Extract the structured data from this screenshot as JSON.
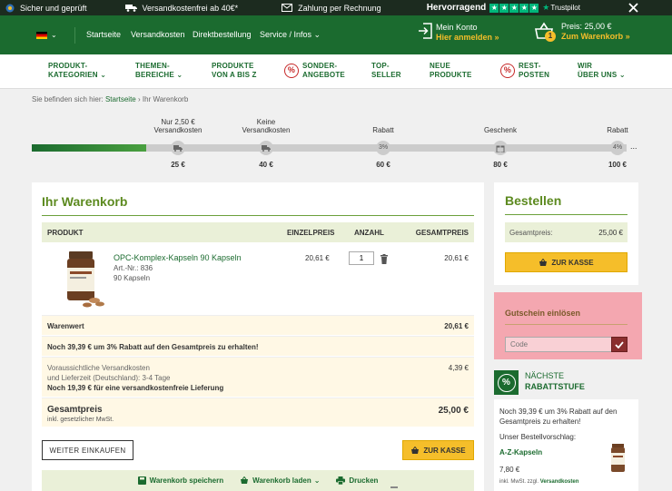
{
  "topbar": {
    "item1": "Sicher und geprüft",
    "item2": "Versandkostenfrei ab 40€*",
    "item3": "Zahlung per Rechnung",
    "rating_label": "Hervorragend",
    "trustpilot": "Trustpilot"
  },
  "header": {
    "nav": [
      "Startseite",
      "Versandkosten",
      "Direktbestellung",
      "Service / Infos"
    ],
    "account_title": "Mein Konto",
    "account_link": "Hier anmelden »",
    "cart_count": "1",
    "cart_price": "Preis: 25,00 €",
    "cart_link": "Zum Warenkorb »"
  },
  "nav": {
    "items": [
      {
        "l1": "PRODUKT-",
        "l2": "KATEGORIEN"
      },
      {
        "l1": "THEMEN-",
        "l2": "BEREICHE"
      },
      {
        "l1": "PRODUKTE",
        "l2": "VON A BIS Z"
      },
      {
        "l1": "SONDER-",
        "l2": "ANGEBOTE"
      },
      {
        "l1": "TOP-",
        "l2": "SELLER"
      },
      {
        "l1": "NEUE",
        "l2": "PRODUKTE"
      },
      {
        "l1": "REST-",
        "l2": "POSTEN"
      },
      {
        "l1": "WIR",
        "l2": "ÜBER UNS"
      }
    ]
  },
  "breadcrumb": {
    "prefix": "Sie befinden sich hier:",
    "home": "Startseite",
    "sep": "›",
    "current": "Ihr Warenkorb"
  },
  "progress": {
    "steps": [
      {
        "top": "Nur 2,50 €",
        "top2": "Versandkosten",
        "badge": "",
        "bottom": "25 €"
      },
      {
        "top": "Keine",
        "top2": "Versandkosten",
        "badge": "",
        "bottom": "40 €"
      },
      {
        "top": "Rabatt",
        "top2": "",
        "badge": "3%",
        "bottom": "60 €"
      },
      {
        "top": "Geschenk",
        "top2": "",
        "badge": "",
        "bottom": "80 €"
      },
      {
        "top": "Rabatt",
        "top2": "",
        "badge": "4%",
        "bottom": "100 €"
      }
    ],
    "more": "...",
    "fill": 0.193
  },
  "cart": {
    "title": "Ihr Warenkorb",
    "headers": [
      "PRODUKT",
      "EINZELPREIS",
      "ANZAHL",
      "GESAMTPREIS"
    ],
    "item": {
      "name": "OPC-Komplex-Kapseln 90 Kapseln",
      "art": "Art.-Nr.: 836",
      "qty_text": "90 Kapseln",
      "price": "20,61 €",
      "qty": "1",
      "total": "20,61 €"
    },
    "warenwert_label": "Warenwert",
    "warenwert": "20,61 €",
    "promo": "Noch 39,39 € um 3% Rabatt auf den Gesamtpreis zu erhalten!",
    "ship1": "Voraussichtliche Versandkosten",
    "ship2": "und Lieferzeit (Deutschland): 3-4 Tage",
    "ship3": "Noch 19,39 € für eine versandkostenfreie Lieferung",
    "ship_price": "4,39 €",
    "total_label": "Gesamtpreis",
    "total_sub": "inkl. gesetzlicher MwSt.",
    "total": "25,00 €",
    "continue": "WEITER EINKAUFEN",
    "checkout": "ZUR KASSE",
    "actions": [
      "Warenkorb speichern",
      "Warenkorb laden",
      "Drucken"
    ]
  },
  "order": {
    "title": "Bestellen",
    "total_label": "Gesamtpreis:",
    "total": "25,00 €",
    "checkout": "ZUR KASSE"
  },
  "voucher": {
    "title": "Gutschein einlösen",
    "placeholder": "Code"
  },
  "discount": {
    "badge": "%",
    "l1": "NÄCHSTE",
    "l2": "RABATTSTUFE",
    "text": "Noch 39,39 € um 3% Rabatt auf den Gesamtpreis zu erhalten!",
    "suggest": "Unser Bestellvorschlag:",
    "product": "A-Z-Kapseln",
    "price": "7,80 €",
    "tax": "inkl. MwSt. zzgl.",
    "shipping": "Versandkosten"
  },
  "colors": {
    "green": "#1b6b2f",
    "accent": "#5c8a1f",
    "yellow": "#f5be2a",
    "pink": "#f4a7b0"
  }
}
